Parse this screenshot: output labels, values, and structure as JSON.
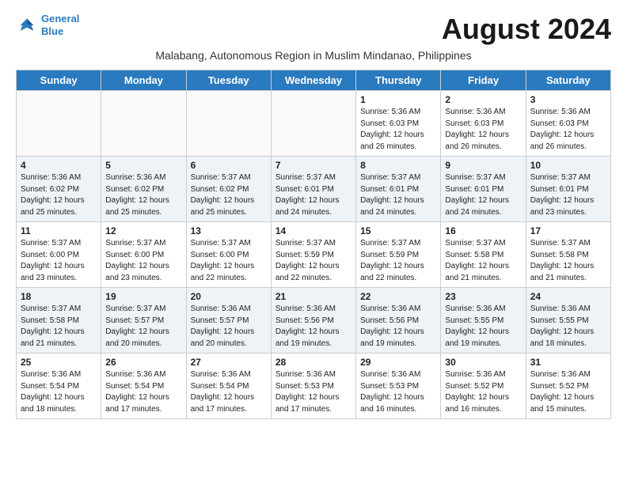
{
  "logo": {
    "line1": "General",
    "line2": "Blue"
  },
  "title": "August 2024",
  "subtitle": "Malabang, Autonomous Region in Muslim Mindanao, Philippines",
  "weekdays": [
    "Sunday",
    "Monday",
    "Tuesday",
    "Wednesday",
    "Thursday",
    "Friday",
    "Saturday"
  ],
  "weeks": [
    [
      {
        "day": "",
        "info": ""
      },
      {
        "day": "",
        "info": ""
      },
      {
        "day": "",
        "info": ""
      },
      {
        "day": "",
        "info": ""
      },
      {
        "day": "1",
        "info": "Sunrise: 5:36 AM\nSunset: 6:03 PM\nDaylight: 12 hours\nand 26 minutes."
      },
      {
        "day": "2",
        "info": "Sunrise: 5:36 AM\nSunset: 6:03 PM\nDaylight: 12 hours\nand 26 minutes."
      },
      {
        "day": "3",
        "info": "Sunrise: 5:36 AM\nSunset: 6:03 PM\nDaylight: 12 hours\nand 26 minutes."
      }
    ],
    [
      {
        "day": "4",
        "info": "Sunrise: 5:36 AM\nSunset: 6:02 PM\nDaylight: 12 hours\nand 25 minutes."
      },
      {
        "day": "5",
        "info": "Sunrise: 5:36 AM\nSunset: 6:02 PM\nDaylight: 12 hours\nand 25 minutes."
      },
      {
        "day": "6",
        "info": "Sunrise: 5:37 AM\nSunset: 6:02 PM\nDaylight: 12 hours\nand 25 minutes."
      },
      {
        "day": "7",
        "info": "Sunrise: 5:37 AM\nSunset: 6:01 PM\nDaylight: 12 hours\nand 24 minutes."
      },
      {
        "day": "8",
        "info": "Sunrise: 5:37 AM\nSunset: 6:01 PM\nDaylight: 12 hours\nand 24 minutes."
      },
      {
        "day": "9",
        "info": "Sunrise: 5:37 AM\nSunset: 6:01 PM\nDaylight: 12 hours\nand 24 minutes."
      },
      {
        "day": "10",
        "info": "Sunrise: 5:37 AM\nSunset: 6:01 PM\nDaylight: 12 hours\nand 23 minutes."
      }
    ],
    [
      {
        "day": "11",
        "info": "Sunrise: 5:37 AM\nSunset: 6:00 PM\nDaylight: 12 hours\nand 23 minutes."
      },
      {
        "day": "12",
        "info": "Sunrise: 5:37 AM\nSunset: 6:00 PM\nDaylight: 12 hours\nand 23 minutes."
      },
      {
        "day": "13",
        "info": "Sunrise: 5:37 AM\nSunset: 6:00 PM\nDaylight: 12 hours\nand 22 minutes."
      },
      {
        "day": "14",
        "info": "Sunrise: 5:37 AM\nSunset: 5:59 PM\nDaylight: 12 hours\nand 22 minutes."
      },
      {
        "day": "15",
        "info": "Sunrise: 5:37 AM\nSunset: 5:59 PM\nDaylight: 12 hours\nand 22 minutes."
      },
      {
        "day": "16",
        "info": "Sunrise: 5:37 AM\nSunset: 5:58 PM\nDaylight: 12 hours\nand 21 minutes."
      },
      {
        "day": "17",
        "info": "Sunrise: 5:37 AM\nSunset: 5:58 PM\nDaylight: 12 hours\nand 21 minutes."
      }
    ],
    [
      {
        "day": "18",
        "info": "Sunrise: 5:37 AM\nSunset: 5:58 PM\nDaylight: 12 hours\nand 21 minutes."
      },
      {
        "day": "19",
        "info": "Sunrise: 5:37 AM\nSunset: 5:57 PM\nDaylight: 12 hours\nand 20 minutes."
      },
      {
        "day": "20",
        "info": "Sunrise: 5:36 AM\nSunset: 5:57 PM\nDaylight: 12 hours\nand 20 minutes."
      },
      {
        "day": "21",
        "info": "Sunrise: 5:36 AM\nSunset: 5:56 PM\nDaylight: 12 hours\nand 19 minutes."
      },
      {
        "day": "22",
        "info": "Sunrise: 5:36 AM\nSunset: 5:56 PM\nDaylight: 12 hours\nand 19 minutes."
      },
      {
        "day": "23",
        "info": "Sunrise: 5:36 AM\nSunset: 5:55 PM\nDaylight: 12 hours\nand 19 minutes."
      },
      {
        "day": "24",
        "info": "Sunrise: 5:36 AM\nSunset: 5:55 PM\nDaylight: 12 hours\nand 18 minutes."
      }
    ],
    [
      {
        "day": "25",
        "info": "Sunrise: 5:36 AM\nSunset: 5:54 PM\nDaylight: 12 hours\nand 18 minutes."
      },
      {
        "day": "26",
        "info": "Sunrise: 5:36 AM\nSunset: 5:54 PM\nDaylight: 12 hours\nand 17 minutes."
      },
      {
        "day": "27",
        "info": "Sunrise: 5:36 AM\nSunset: 5:54 PM\nDaylight: 12 hours\nand 17 minutes."
      },
      {
        "day": "28",
        "info": "Sunrise: 5:36 AM\nSunset: 5:53 PM\nDaylight: 12 hours\nand 17 minutes."
      },
      {
        "day": "29",
        "info": "Sunrise: 5:36 AM\nSunset: 5:53 PM\nDaylight: 12 hours\nand 16 minutes."
      },
      {
        "day": "30",
        "info": "Sunrise: 5:36 AM\nSunset: 5:52 PM\nDaylight: 12 hours\nand 16 minutes."
      },
      {
        "day": "31",
        "info": "Sunrise: 5:36 AM\nSunset: 5:52 PM\nDaylight: 12 hours\nand 15 minutes."
      }
    ]
  ]
}
